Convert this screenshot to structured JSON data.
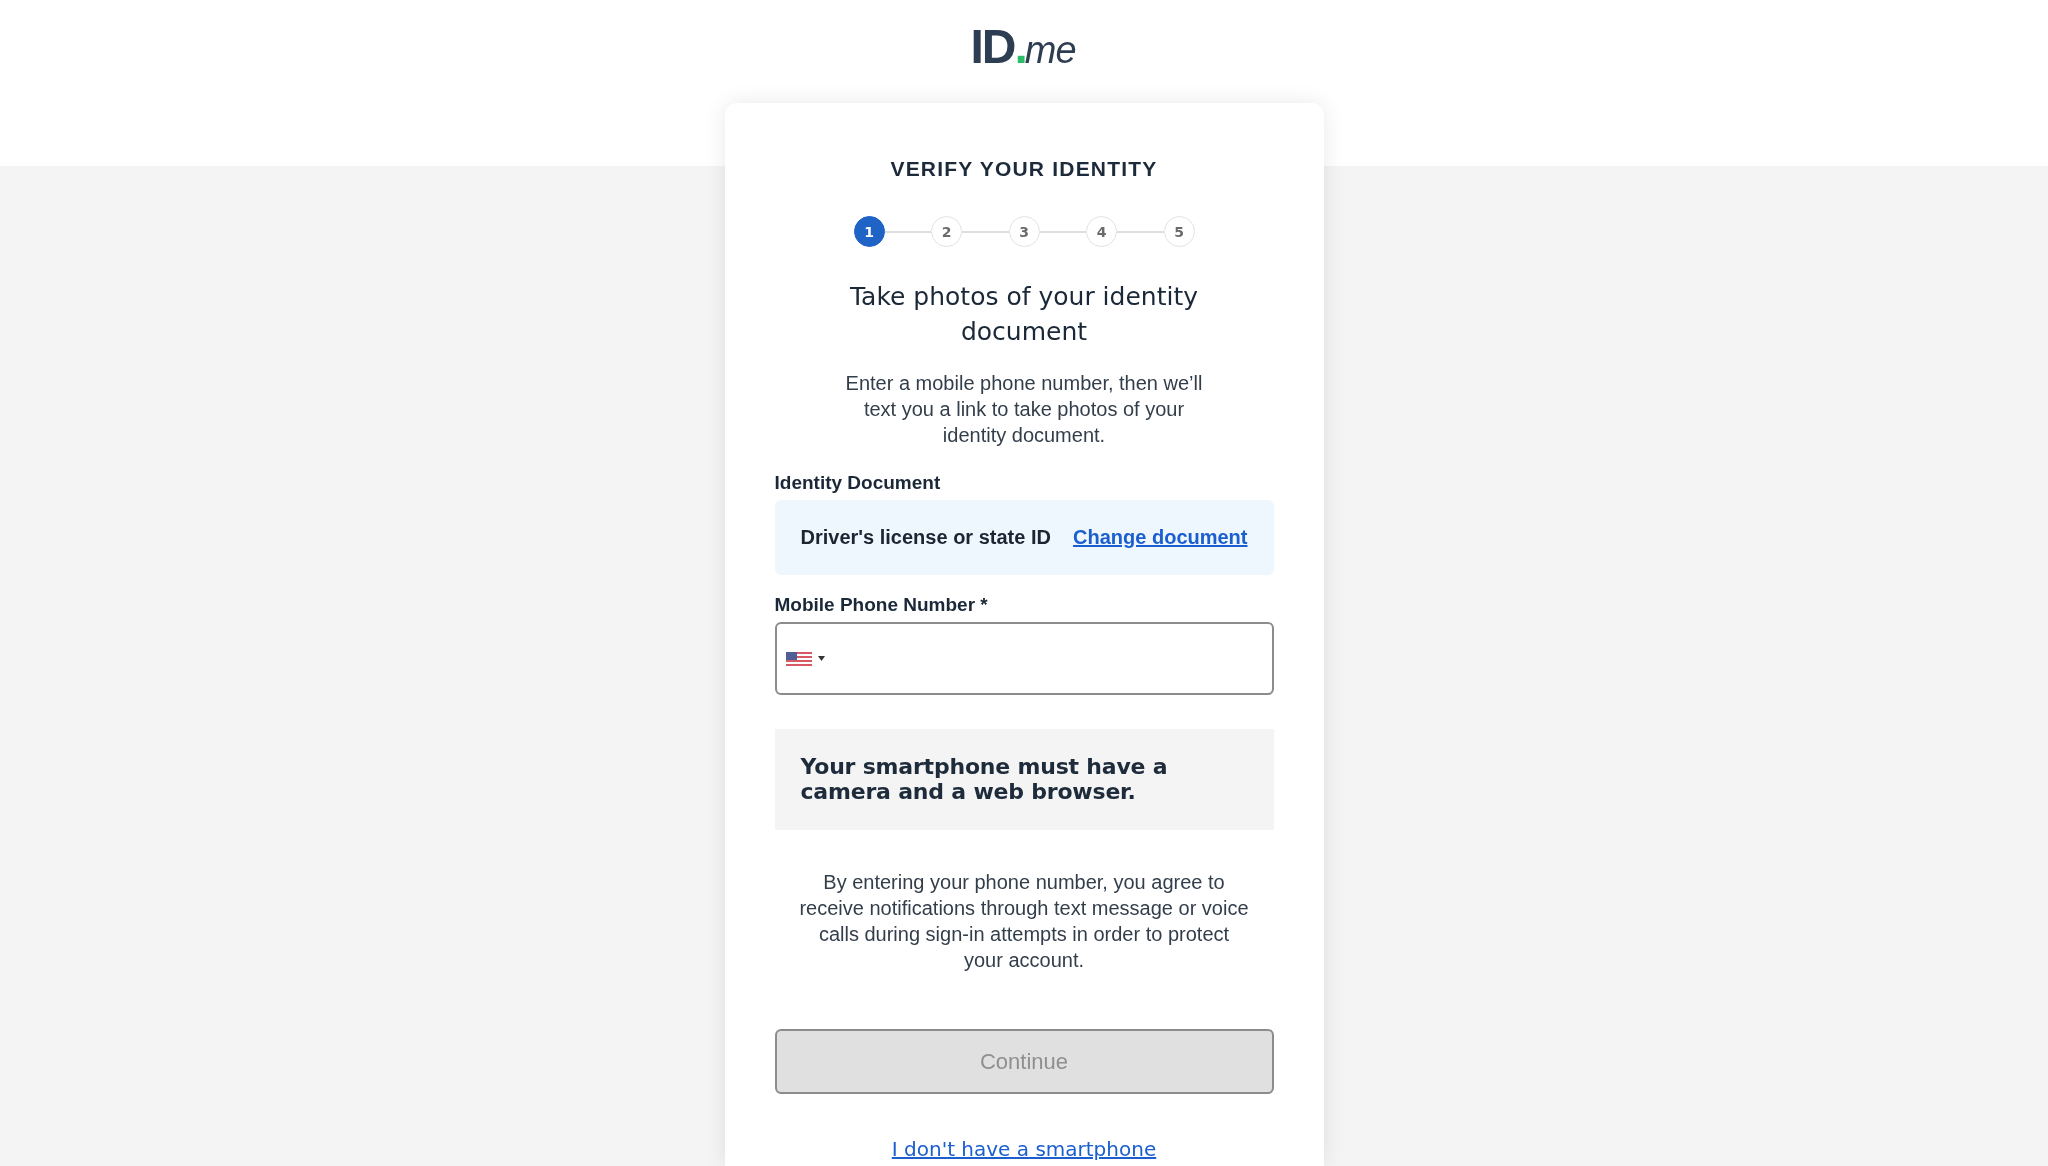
{
  "logo": {
    "mark": "ID",
    "dot": ".",
    "suffix": "me"
  },
  "card": {
    "heading": "VERIFY YOUR IDENTITY",
    "steps": [
      {
        "label": "1",
        "selected": true
      },
      {
        "label": "2",
        "selected": false
      },
      {
        "label": "3",
        "selected": false
      },
      {
        "label": "4",
        "selected": false
      },
      {
        "label": "5",
        "selected": false
      }
    ],
    "title": "Take photos of your identity document",
    "description": "Enter a mobile phone number, then we’ll text you a link to take photos of your identity document.",
    "identity_document": {
      "label": "Identity Document",
      "value": "Driver's license or state ID",
      "link": "Change document"
    },
    "phone_field": {
      "label": "Mobile Phone Number *"
    },
    "notice": "Your smartphone must have a camera and a web browser.",
    "consent": "By entering your phone number, you agree to receive notifications through text message or voice calls during sign-in attempts in order to protect your account.",
    "continue_button": {
      "label": "Continue",
      "disabled": true
    },
    "no_smartphone_link": "I don't have a smartphone"
  }
}
